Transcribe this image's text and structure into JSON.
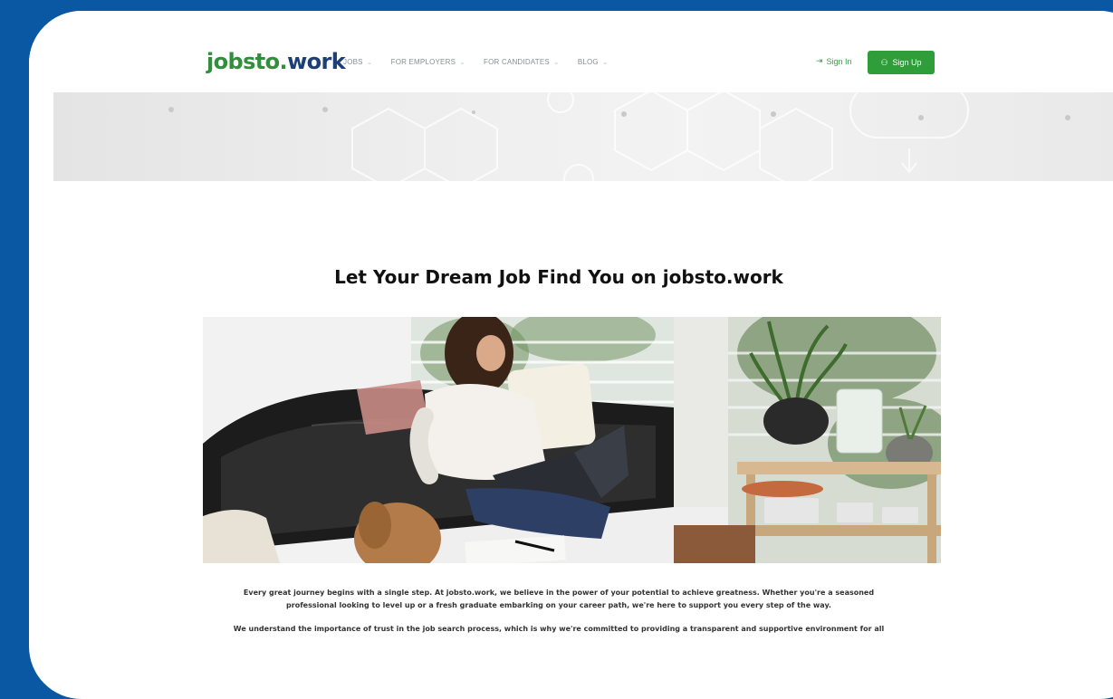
{
  "brand": {
    "logo_part1": "jobsto",
    "logo_dot": ".",
    "logo_part2": "work"
  },
  "nav": {
    "items": [
      {
        "label": "JOBS"
      },
      {
        "label": "FOR EMPLOYERS"
      },
      {
        "label": "FOR CANDIDATES"
      },
      {
        "label": "BLOG"
      }
    ]
  },
  "auth": {
    "signin_label": "Sign In",
    "signup_label": "Sign Up"
  },
  "hero": {
    "headline": "Let Your Dream Job Find You on jobsto.work"
  },
  "body": {
    "paragraph1_line1": "Every great journey begins with a single step. At jobsto.work, we believe in the power of your potential to achieve greatness. Whether you're a seasoned",
    "paragraph1_line2": "professional looking to level up or a fresh graduate embarking on your career path, we're here to support you every step of the way.",
    "paragraph2_line1": "We understand the importance of trust in the job search process, which is why we're committed to providing a transparent and supportive environment for all"
  },
  "colors": {
    "background": "#0a57a3",
    "brand_green": "#2f9e3a",
    "brand_blue": "#1d3f78"
  },
  "icons": [
    "chevron-down-icon",
    "sign-in-icon",
    "user-add-icon"
  ]
}
